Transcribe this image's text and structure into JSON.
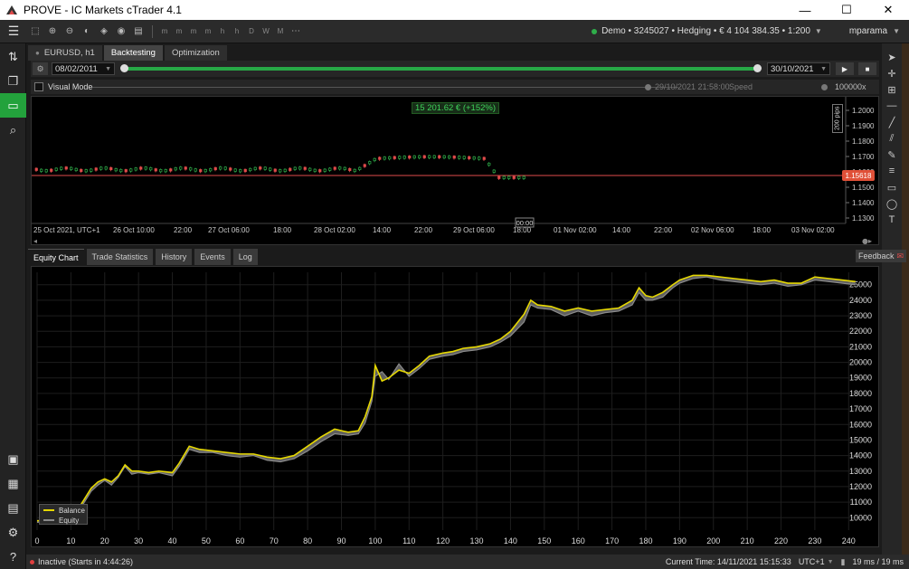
{
  "window": {
    "title": "PROVE - IC Markets cTrader 4.1",
    "minimize": "—",
    "maximize": "☐",
    "close": "✕"
  },
  "toolbar": {
    "timeframes": [
      "m",
      "m",
      "m",
      "m",
      "h",
      "h",
      "D",
      "W",
      "M"
    ],
    "account": "Demo • 3245027 • Hedging • € 4 104 384.35 • 1:200",
    "user": "mparama"
  },
  "tabs": [
    {
      "label": "EURUSD, h1"
    },
    {
      "label": "Backtesting"
    },
    {
      "label": "Optimization"
    }
  ],
  "backtest": {
    "start_date": "08/02/2011",
    "end_date": "30/10/2021",
    "progress": 1.0,
    "visual_mode_label": "Visual Mode",
    "visual_mode_checked": false,
    "visual_time": "29/10/2021 21:58:00",
    "speed_label": "Speed",
    "speed_value": "100000x"
  },
  "price_chart": {
    "pnl_label": "15 201.62 € (+152%)",
    "pips_label": "200 pips",
    "current_price": "1.15618",
    "y_ticks": [
      "1.2000",
      "1.1900",
      "1.1800",
      "1.1700",
      "1.1600",
      "1.1500",
      "1.1400",
      "1.1300"
    ],
    "x_ticks": [
      "25 Oct 2021, UTC+1",
      "26 Oct 10:00",
      "22:00",
      "27 Oct 06:00",
      "18:00",
      "28 Oct 02:00",
      "14:00",
      "22:00",
      "29 Oct 06:00",
      "18:00",
      "01 Nov 02:00",
      "14:00",
      "22:00",
      "02 Nov 06:00",
      "18:00",
      "03 Nov 02:00"
    ],
    "crosshair_time": "00:00"
  },
  "bottom_tabs": [
    {
      "label": "Equity Chart"
    },
    {
      "label": "Trade Statistics"
    },
    {
      "label": "History"
    },
    {
      "label": "Events"
    },
    {
      "label": "Log"
    }
  ],
  "feedback_label": "Feedback",
  "chart_data": {
    "type": "line",
    "title": "",
    "xlabel": "",
    "ylabel": "",
    "xlim": [
      0,
      245
    ],
    "ylim": [
      9200,
      25800
    ],
    "x_ticks": [
      0,
      10,
      20,
      30,
      40,
      50,
      60,
      70,
      80,
      90,
      100,
      110,
      120,
      130,
      140,
      150,
      160,
      170,
      180,
      190,
      200,
      210,
      220,
      230,
      240
    ],
    "y_ticks": [
      10000,
      11000,
      12000,
      13000,
      14000,
      15000,
      16000,
      17000,
      18000,
      19000,
      20000,
      21000,
      22000,
      23000,
      24000,
      25000
    ],
    "grid": true,
    "legend": "bottom-left",
    "series": [
      {
        "name": "Balance",
        "color": "#e6d800",
        "x": [
          0,
          10,
          12,
          14,
          16,
          18,
          20,
          22,
          24,
          26,
          28,
          30,
          33,
          36,
          40,
          42,
          45,
          48,
          52,
          56,
          60,
          64,
          68,
          72,
          76,
          80,
          84,
          88,
          92,
          95,
          97,
          99,
          100,
          102,
          104,
          107,
          110,
          113,
          116,
          120,
          123,
          126,
          130,
          134,
          137,
          140,
          144,
          146,
          148,
          152,
          156,
          160,
          164,
          168,
          172,
          176,
          178,
          180,
          182,
          185,
          188,
          190,
          194,
          198,
          202,
          206,
          210,
          214,
          218,
          222,
          226,
          230,
          234,
          238,
          242
        ],
        "values": [
          9800,
          9900,
          10500,
          11200,
          11900,
          12300,
          12500,
          12300,
          12700,
          13400,
          13000,
          13000,
          12900,
          13000,
          12900,
          13500,
          14600,
          14400,
          14300,
          14200,
          14100,
          14100,
          13900,
          13800,
          14000,
          14600,
          15200,
          15700,
          15500,
          15600,
          16500,
          17800,
          19800,
          18800,
          19000,
          19500,
          19300,
          19800,
          20400,
          20600,
          20700,
          20900,
          21000,
          21200,
          21500,
          22000,
          23100,
          24000,
          23700,
          23600,
          23300,
          23500,
          23300,
          23400,
          23500,
          24000,
          24800,
          24300,
          24200,
          24500,
          25000,
          25300,
          25600,
          25600,
          25500,
          25400,
          25300,
          25200,
          25300,
          25100,
          25100,
          25500,
          25400,
          25300,
          25200
        ]
      },
      {
        "name": "Equity",
        "color": "#8a8a8a",
        "x": [
          0,
          10,
          12,
          14,
          16,
          18,
          20,
          22,
          24,
          26,
          28,
          30,
          33,
          36,
          40,
          42,
          45,
          48,
          52,
          56,
          60,
          64,
          68,
          72,
          76,
          80,
          84,
          88,
          92,
          95,
          97,
          99,
          100,
          102,
          104,
          107,
          110,
          113,
          116,
          120,
          123,
          126,
          130,
          134,
          137,
          140,
          144,
          146,
          148,
          152,
          156,
          160,
          164,
          168,
          172,
          176,
          178,
          180,
          182,
          185,
          188,
          190,
          194,
          198,
          202,
          206,
          210,
          214,
          218,
          222,
          226,
          230,
          234,
          238,
          242
        ],
        "values": [
          9700,
          9800,
          10300,
          11000,
          11700,
          12100,
          12400,
          12100,
          12600,
          13300,
          12800,
          12900,
          12800,
          12900,
          12700,
          13300,
          14400,
          14200,
          14200,
          14000,
          13900,
          14000,
          13700,
          13600,
          13800,
          14300,
          14900,
          15400,
          15300,
          15400,
          16100,
          17500,
          19100,
          19400,
          18900,
          19900,
          19100,
          19600,
          20200,
          20400,
          20500,
          20700,
          20800,
          21000,
          21300,
          21700,
          22600,
          23700,
          23500,
          23400,
          23000,
          23300,
          23000,
          23200,
          23300,
          23700,
          24500,
          24000,
          24000,
          24200,
          24800,
          25100,
          25400,
          25500,
          25300,
          25200,
          25100,
          25000,
          25100,
          24900,
          25000,
          25300,
          25200,
          25100,
          25000
        ]
      }
    ]
  },
  "status": {
    "state": "Inactive (Starts in 4:44:26)",
    "current_time": "Current Time: 14/11/2021 15:15:33",
    "timezone": "UTC+1",
    "latency": "19 ms / 19 ms"
  }
}
